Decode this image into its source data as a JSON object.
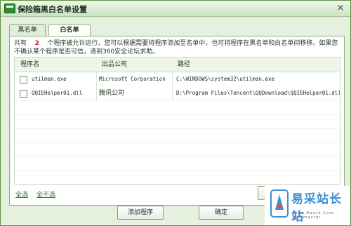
{
  "window": {
    "title": "保险箱黑白名单设置",
    "close_glyph": "×"
  },
  "tabs": [
    {
      "label": "黑名单"
    },
    {
      "label": "白名单"
    }
  ],
  "description": {
    "prefix": "共有",
    "count": "2",
    "text": "个程序被允许运行。您可以根据需要将程序添加至名单中，也可将程序在黑名单和白名单间移移。如果您不确认某个程序是否可信，请到360安全论坛求助。"
  },
  "table": {
    "headers": [
      "程序名",
      "出品公司",
      "路径"
    ],
    "rows": [
      {
        "name": "utilman.exe",
        "company": "Microsoft Corporation",
        "path": "C:\\WINDOWS\\system32\\utilman.exe"
      },
      {
        "name": "QQIEHelper01.dll",
        "company": "腾讯公司",
        "path": "D:\\Program Files\\Tencent\\QQDownload\\QQIEHelper01.dll"
      }
    ]
  },
  "links": {
    "select_all": "全选",
    "select_none": "全不选"
  },
  "buttons": {
    "add_program": "添加程序",
    "ok": "确定"
  },
  "watermark": {
    "text": "易采站长站",
    "sub": "Www.Easck.Com Webmaster",
    "color": "#3c8fd6"
  }
}
